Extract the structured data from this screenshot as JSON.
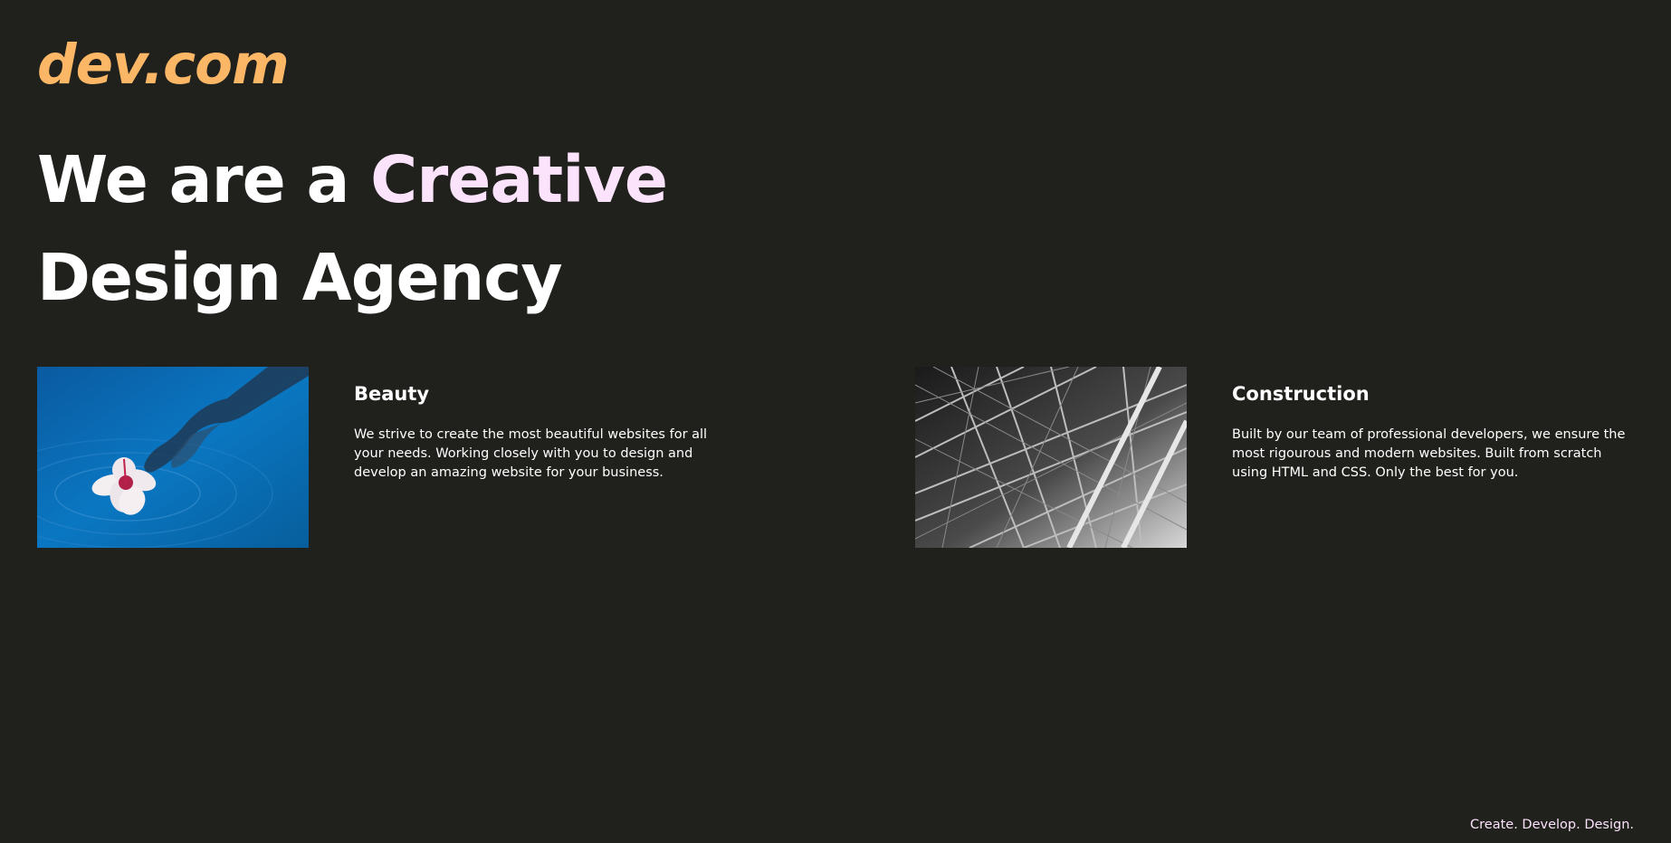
{
  "logo": "dev.com",
  "headline": {
    "prefix": "We are a",
    "accent": "Creative",
    "line2": "Design Agency"
  },
  "cards": [
    {
      "title": "Beauty",
      "text": "We strive to create the most beautiful websites for all your needs. Working closely with you to design and develop an amazing website for your business.",
      "image": "hand-placing-flower-in-blue-water"
    },
    {
      "title": "Construction",
      "text": "Built by our team of professional developers, we ensure the most rigourous and modern websites. Built from scratch using HTML and CSS. Only the best for you.",
      "image": "steel-frame-structure-black-and-white"
    }
  ],
  "footer": "Create. Develop. Design.",
  "colors": {
    "background": "#20201d",
    "logo": "#fbb766",
    "accent": "#fbe3fb",
    "text": "#ffffff"
  }
}
